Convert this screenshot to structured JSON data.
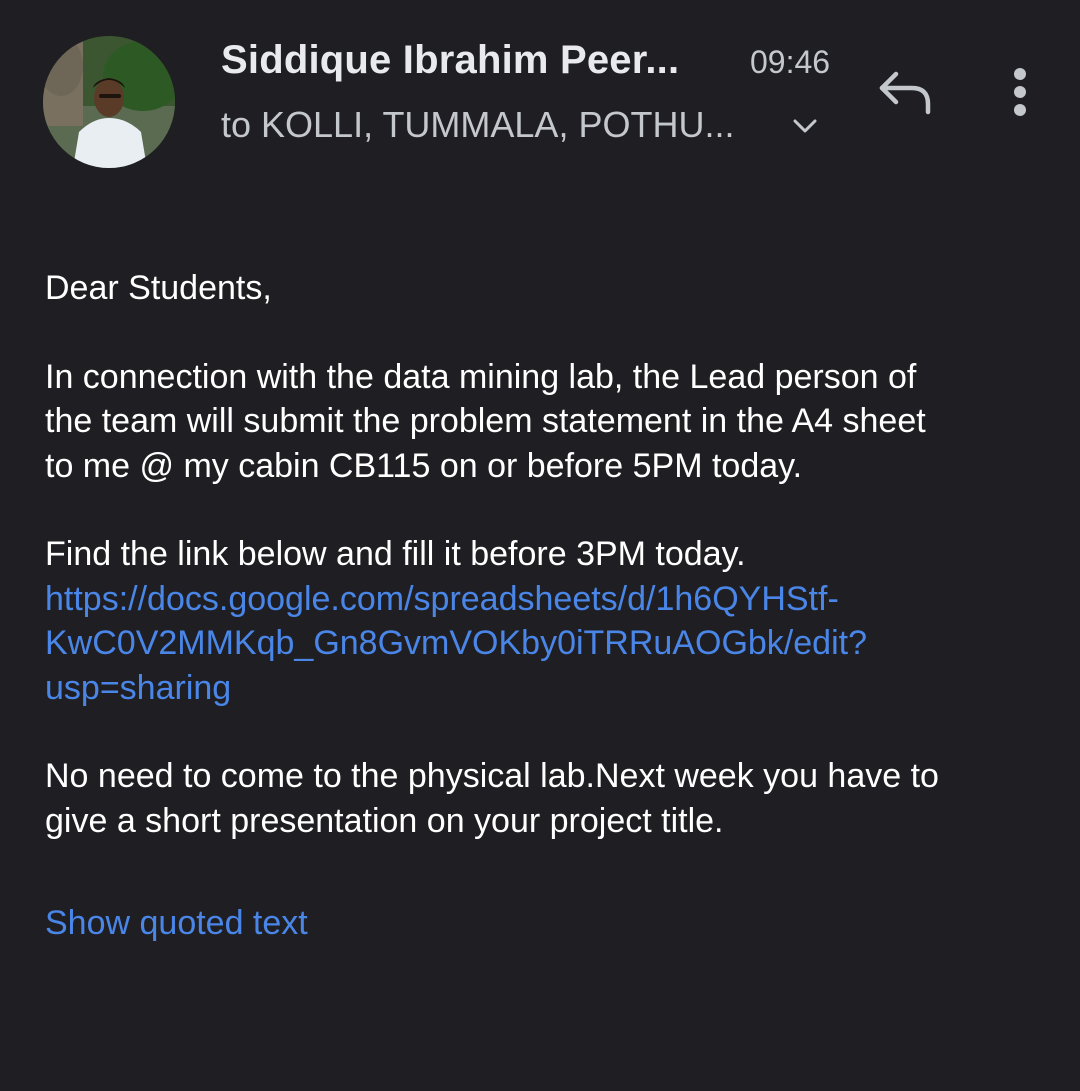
{
  "header": {
    "sender_name": "Siddique Ibrahim Peer...",
    "time": "09:46",
    "recipients": "to KOLLI, TUMMALA, POTHU..."
  },
  "icons": {
    "expand": "chevron-down-icon",
    "reply": "reply-icon",
    "more": "more-vert-icon",
    "avatar": "avatar"
  },
  "body": {
    "greeting": "Dear Students,",
    "para1": [
      "In connection with the data mining lab, the Lead person of",
      "the team will submit the problem statement in the A4 sheet",
      "to me @ my cabin CB115 on or  before 5PM today."
    ],
    "para2": "Find the link below and fill it before 3PM today.",
    "link_lines": [
      "https://docs.google.com/spreadsheets/d/1h6QYHStf-",
      "KwC0V2MMKqb_Gn8GvmVOKby0iTRRuAOGbk/edit?",
      "usp=sharing"
    ],
    "para3": [
      "No need to come to the physical lab.Next week you have to",
      "give a short presentation on your project title."
    ]
  },
  "footer": {
    "show_quoted": "Show quoted text"
  },
  "colors": {
    "background": "#1f1f23",
    "link": "#4a86e8",
    "secondary_text": "#c4c7cc"
  }
}
